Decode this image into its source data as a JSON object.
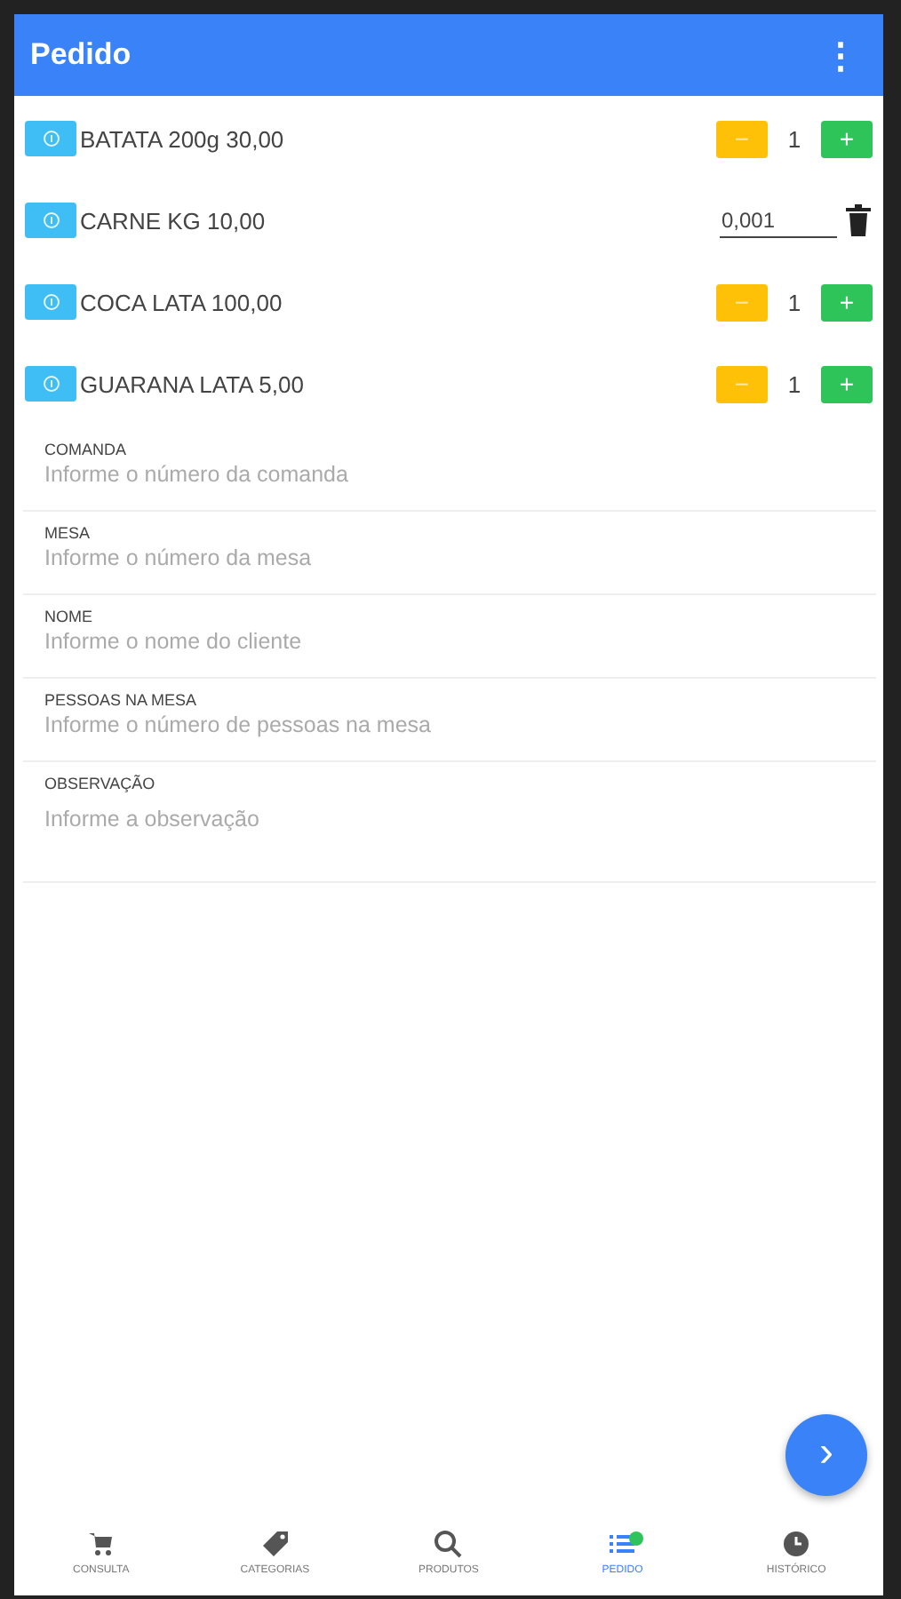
{
  "header": {
    "title": "Pedido",
    "menu_icon": "⋮"
  },
  "items": [
    {
      "kind": "counter",
      "name": "BATATA 200g 30,00",
      "quantity": "1",
      "minus": "−",
      "plus": "+"
    },
    {
      "kind": "weight",
      "name": "CARNE KG 10,00",
      "quantity": "0,001"
    },
    {
      "kind": "counter",
      "name": "COCA LATA 100,00",
      "quantity": "1",
      "minus": "−",
      "plus": "+"
    },
    {
      "kind": "counter",
      "name": "GUARANA LATA 5,00",
      "quantity": "1",
      "minus": "−",
      "plus": "+"
    }
  ],
  "fields": [
    {
      "kind": "line",
      "label": "COMANDA",
      "placeholder": "Informe o número da comanda"
    },
    {
      "kind": "line",
      "label": "MESA",
      "placeholder": "Informe o número da mesa"
    },
    {
      "kind": "line",
      "label": "NOME",
      "placeholder": "Informe o nome do cliente"
    },
    {
      "kind": "line",
      "label": "PESSOAS NA MESA",
      "placeholder": "Informe o número de pessoas na mesa"
    },
    {
      "kind": "area",
      "label": "OBSERVAÇÃO",
      "placeholder": "Informe a observação"
    }
  ],
  "fab": {
    "label": "›"
  },
  "nav": [
    {
      "kind": "cart",
      "label": "CONSULTA",
      "selected": false,
      "badge": false
    },
    {
      "kind": "tag",
      "label": "CATEGORIAS",
      "selected": false,
      "badge": false
    },
    {
      "kind": "search",
      "label": "PRODUTOS",
      "selected": false,
      "badge": false
    },
    {
      "kind": "list",
      "label": "PEDIDO",
      "selected": true,
      "badge": true
    },
    {
      "kind": "clock",
      "label": "HISTÓRICO",
      "selected": false,
      "badge": false
    }
  ]
}
